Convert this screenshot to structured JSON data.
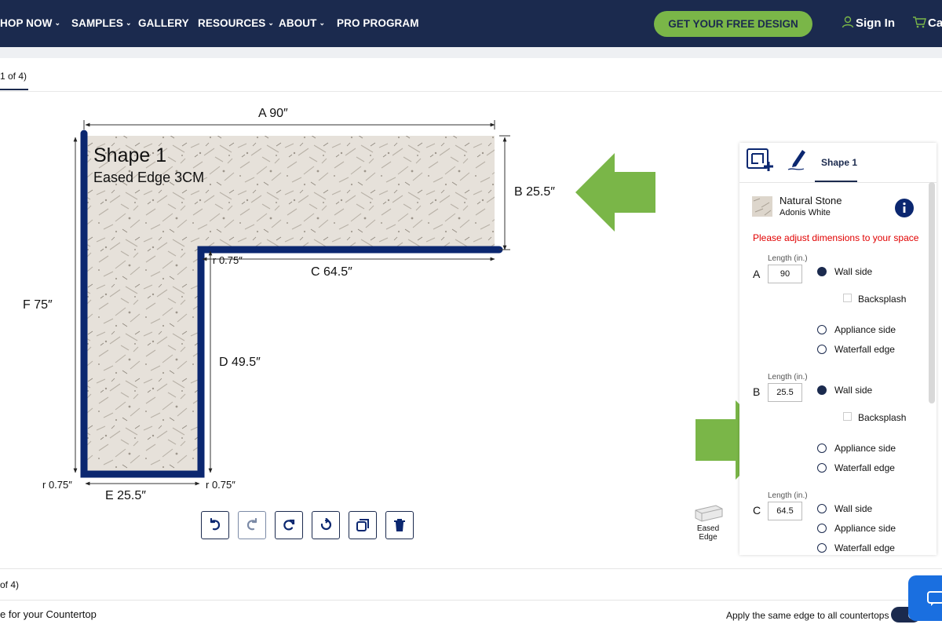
{
  "nav": {
    "items": [
      {
        "label": "HOP NOW",
        "has_chevron": true
      },
      {
        "label": "SAMPLES",
        "has_chevron": true
      },
      {
        "label": "GALLERY",
        "has_chevron": false
      },
      {
        "label": "RESOURCES",
        "has_chevron": true
      },
      {
        "label": "ABOUT",
        "has_chevron": true
      },
      {
        "label": "PRO PROGRAM",
        "has_chevron": false
      }
    ],
    "cta_label": "GET YOUR FREE DESIGN",
    "signin_label": "Sign In",
    "cart_label": "Ca",
    "bg_color": "#1b2a4e",
    "cta_color": "#7ab648"
  },
  "step_tab": {
    "label": "1 of 4)"
  },
  "drawing": {
    "shape_title": "Shape 1",
    "edge_label": "Eased Edge 3CM",
    "dims": {
      "A": "A  90″",
      "B": "B  25.5″",
      "C": "C  64.5″",
      "D": "D  49.5″",
      "E": "E  25.5″",
      "F": "F  75″"
    },
    "radius_inner_top": "r 0.75″",
    "radius_bottom_left": "r 0.75″",
    "radius_bottom_right": "r 0.75″",
    "edge_color": "#0b2770",
    "arrow_color": "#7ab648"
  },
  "toolbar": {
    "buttons": [
      {
        "icon": "undo-icon",
        "enabled": true
      },
      {
        "icon": "redo-icon",
        "enabled": false
      },
      {
        "icon": "rotate-icon",
        "enabled": true
      },
      {
        "icon": "reset-icon",
        "enabled": true
      },
      {
        "icon": "duplicate-icon",
        "enabled": true
      },
      {
        "icon": "trash-icon",
        "enabled": true
      }
    ]
  },
  "edge_preview": {
    "label_line1": "Eased",
    "label_line2": "Edge"
  },
  "panel": {
    "tab_label": "Shape 1",
    "material_type": "Natural Stone",
    "material_name": "Adonis White",
    "warning": "Please adjust dimensions to your space",
    "collapse_glyph": ">",
    "length_label": "Length (in.)",
    "segments": [
      {
        "letter": "A",
        "length": "90",
        "wall_side": true,
        "backsplash": false
      },
      {
        "letter": "B",
        "length": "25.5",
        "wall_side": true,
        "backsplash": false
      },
      {
        "letter": "C",
        "length": "64.5",
        "wall_side": false
      }
    ],
    "option_labels": {
      "wall": "Wall side",
      "backsplash": "Backsplash",
      "appliance": "Appliance side",
      "waterfall": "Waterfall edge"
    }
  },
  "bottom": {
    "step_label": "of 4)",
    "section_label": "e for your Countertop",
    "apply_same_edge": "Apply the same edge to all countertops"
  }
}
